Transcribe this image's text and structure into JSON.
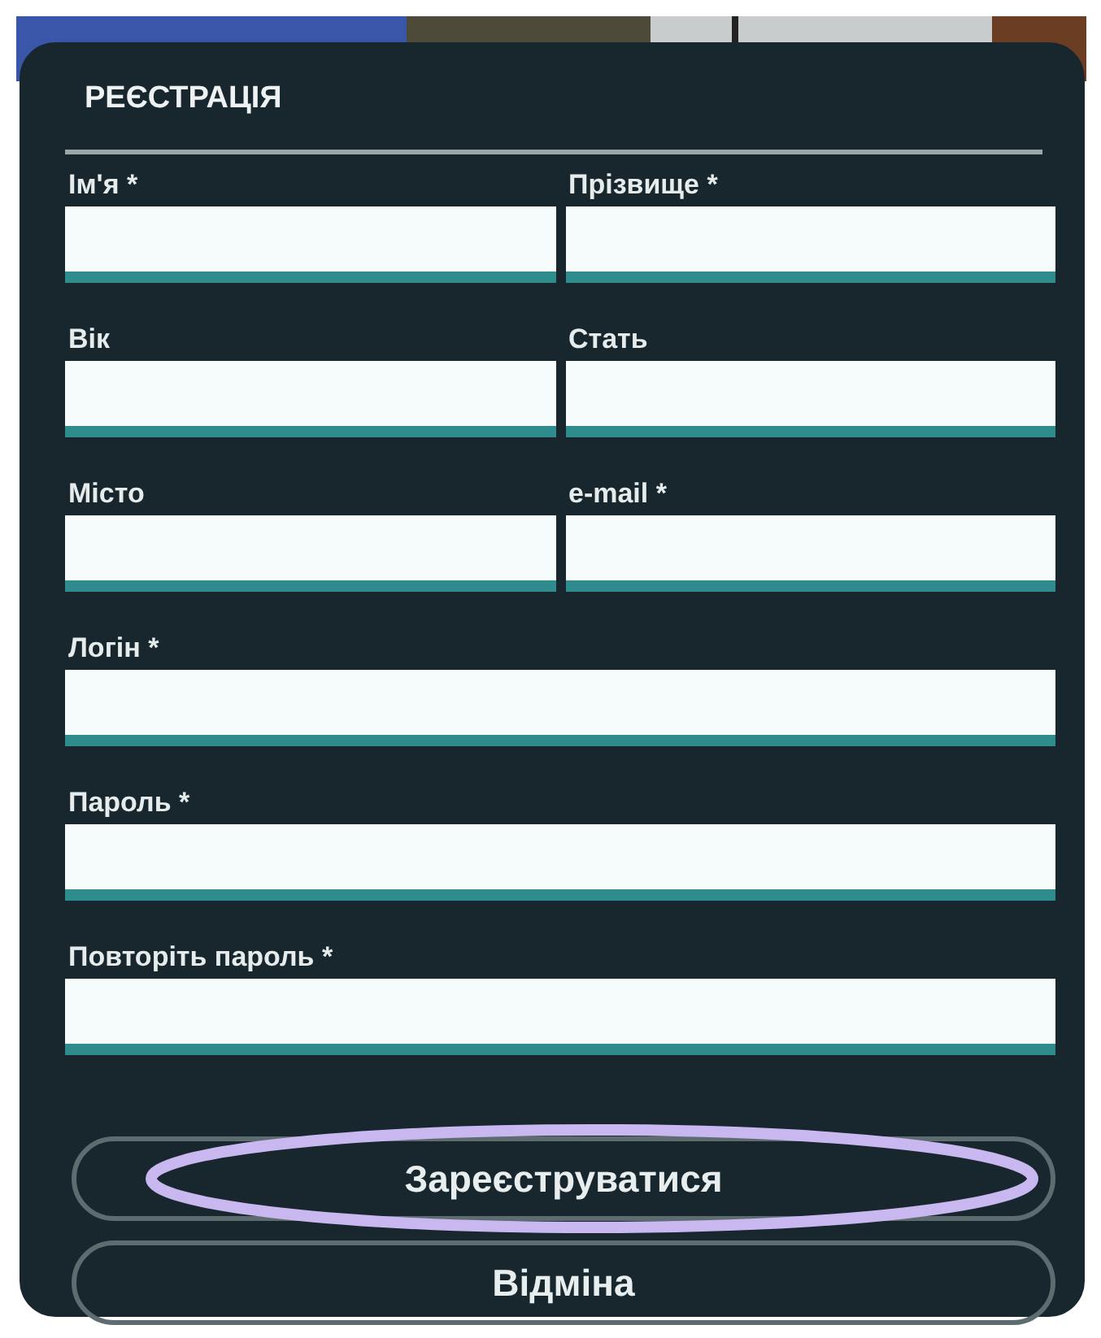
{
  "dialog": {
    "title": "РЕЄСТРАЦІЯ",
    "rows": [
      [
        {
          "label": "Ім'я *"
        },
        {
          "label": "Прізвище *"
        }
      ],
      [
        {
          "label": "Вік"
        },
        {
          "label": "Стать"
        }
      ],
      [
        {
          "label": "Місто"
        },
        {
          "label": "e-mail *"
        }
      ],
      [
        {
          "label": "Логін *"
        }
      ],
      [
        {
          "label": "Пароль *"
        }
      ],
      [
        {
          "label": "Повторіть пароль *"
        }
      ]
    ],
    "buttons": [
      {
        "label": "Зареєструватися",
        "highlighted": true
      },
      {
        "label": "Відміна",
        "highlighted": false
      }
    ]
  }
}
